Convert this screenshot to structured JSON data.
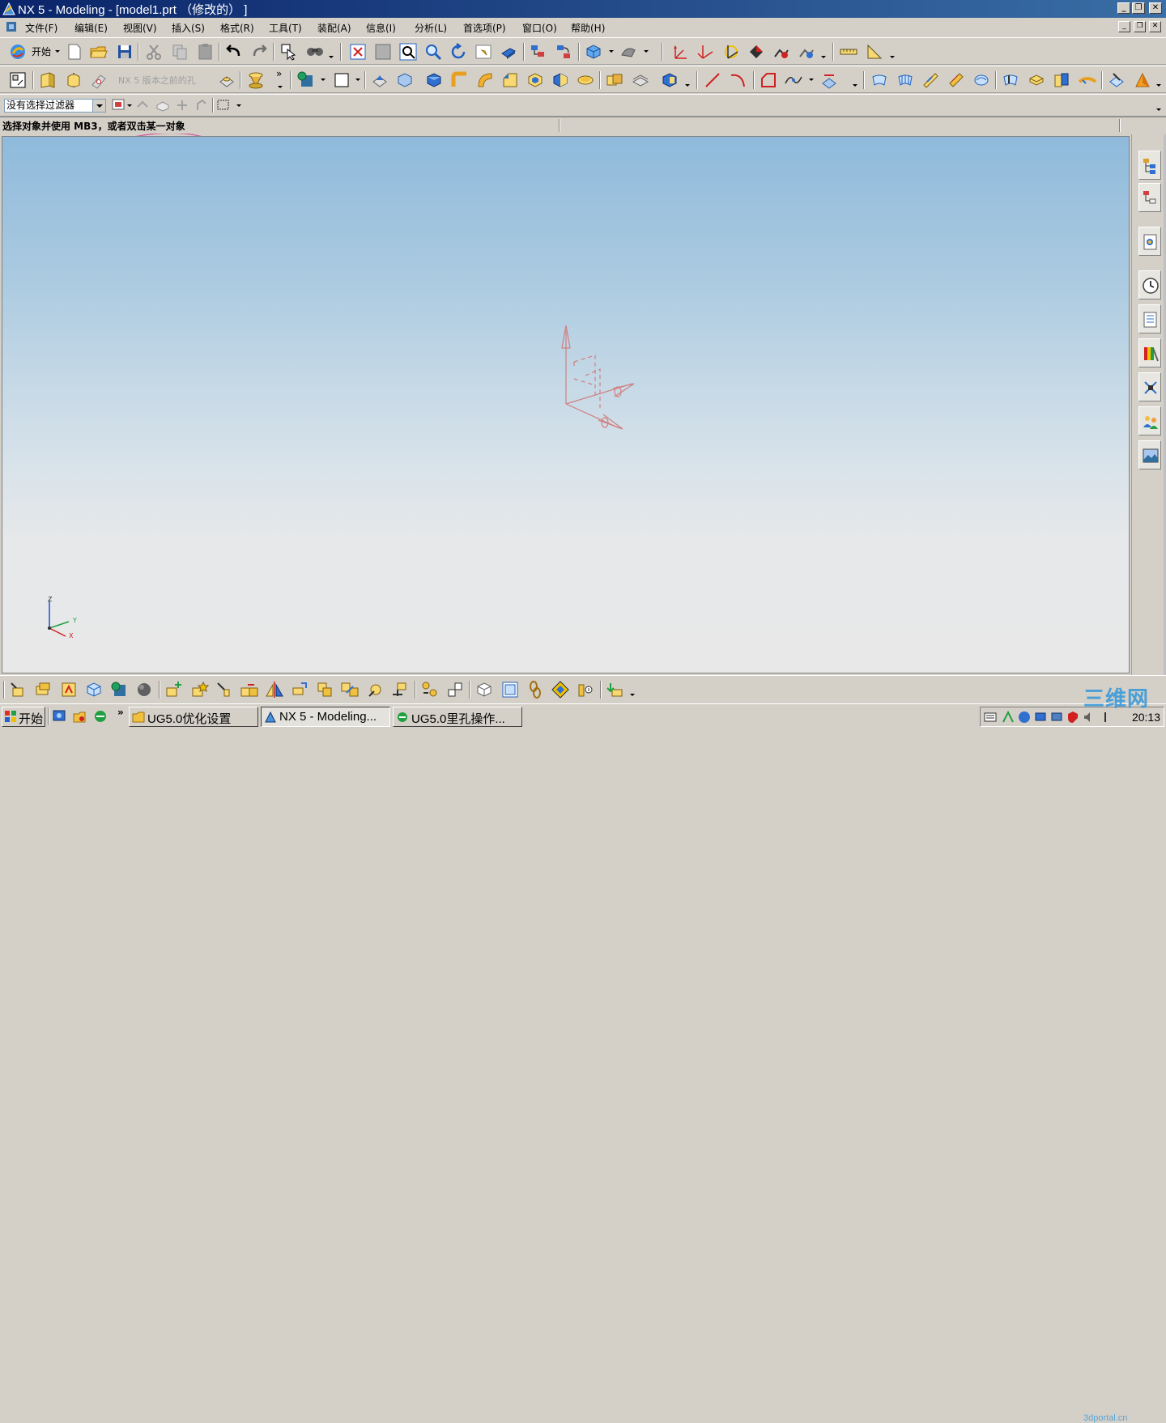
{
  "window": {
    "title": "NX 5 - Modeling - [model1.prt （修改的） ]",
    "minimize_glyph": "_",
    "restore_glyph": "❐",
    "close_glyph": "✕"
  },
  "menubar": {
    "items": [
      "文件(F)",
      "编辑(E)",
      "视图(V)",
      "插入(S)",
      "格式(R)",
      "工具(T)",
      "装配(A)",
      "信息(I)",
      "分析(L)",
      "首选项(P)",
      "窗口(O)",
      "帮助(H)"
    ]
  },
  "toolbar": {
    "start_label": "开始",
    "hole_tooltip": "NX 5 版本之前的孔",
    "overflow_glyph": "»"
  },
  "filter": {
    "value": "没有选择过滤器"
  },
  "status": {
    "cue_line": "选择对象并使用 MB3，或者双击某一对象"
  },
  "graphics": {
    "triad_labels": {
      "z": "Z",
      "y": "Y",
      "x": "X"
    },
    "datum_color": "#d08080"
  },
  "taskbar": {
    "start_label": "开始",
    "quicklaunch_overflow": "»",
    "tasks": [
      {
        "label": "UG5.0优化设置"
      },
      {
        "label": "NX 5 - Modeling..."
      },
      {
        "label": "UG5.0里孔操作..."
      }
    ],
    "clock": "20:13"
  },
  "watermark": {
    "text": "三维网",
    "sub": "3dportal.cn"
  },
  "colors": {
    "titlebar_start": "#0a246a",
    "titlebar_end": "#3a6ea5",
    "chrome": "#d4d0c8",
    "graphics_top": "#8fbadb",
    "graphics_bottom": "#e8e8e8",
    "tooltip_highlight": "#d060a0"
  }
}
